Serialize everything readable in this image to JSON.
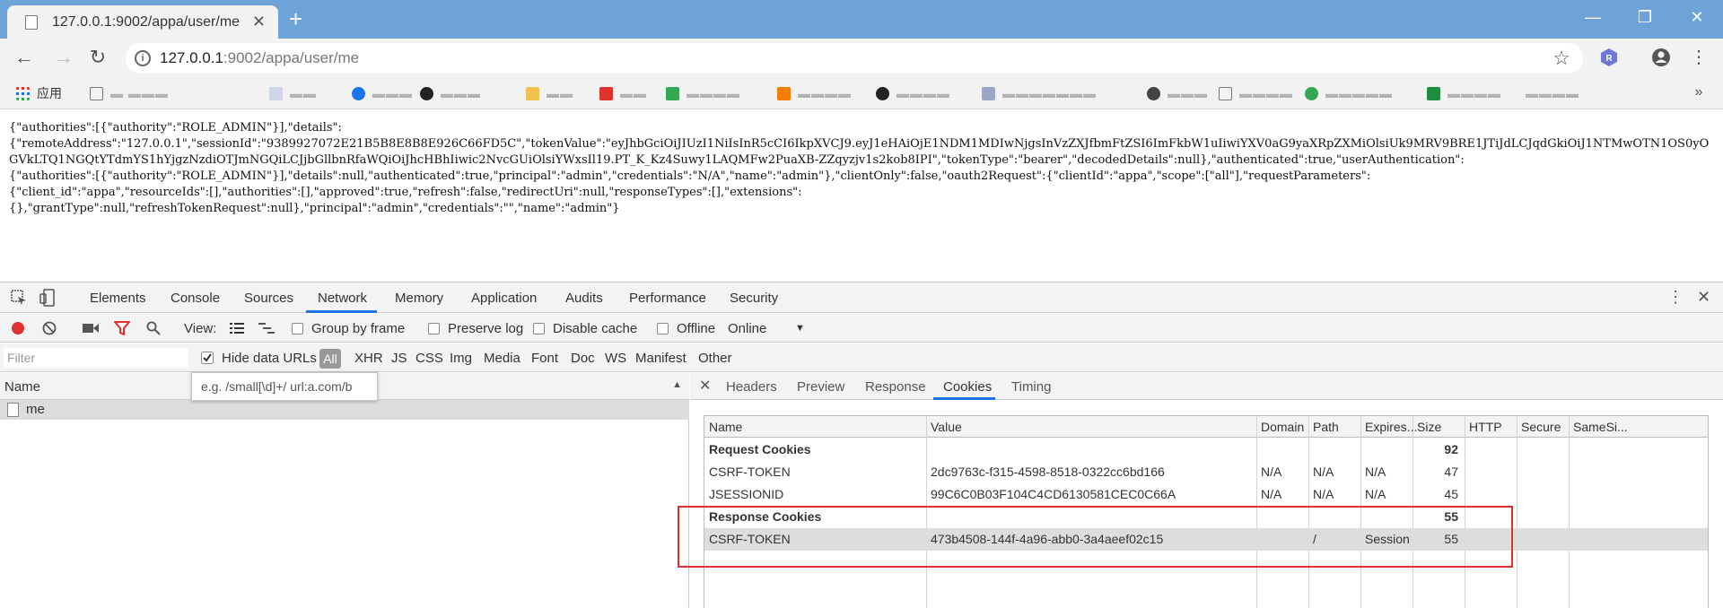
{
  "browser": {
    "tab_title": "127.0.0.1:9002/appa/user/me",
    "url_host": "127.0.0.1",
    "url_rest": ":9002/appa/user/me",
    "new_tab_symbol": "+",
    "bookmarks_apps_label": "应用",
    "accent_color": "#6ea3d8"
  },
  "page": {
    "json_text": "{\"authorities\":[{\"authority\":\"ROLE_ADMIN\"}],\"details\":\n{\"remoteAddress\":\"127.0.0.1\",\"sessionId\":\"9389927072E21B5B8E8B8E926C66FD5C\",\"tokenValue\":\"eyJhbGciOiJIUzI1NiIsInR5cCI6IkpXVCJ9.eyJ1eHAiOjE1NDM1MDIwNjgsInVzZXJfbmFtZSI6ImFkbW1uIiwiYXV0aG9yaXRpZXMiOlsiUk9MRV9BRE1JTiJdLCJqdGkiOiJ1NTMwOTN1OS0yOGVkLTQ1NGQtYTdmYS1hYjgzNzdiOTJmNGQiLCJjbGllbnRfaWQiOiJhcHBhIiwic2NvcGUiOlsiYWxsIl19.PT_K_Kz4Suwy1LAQMFw2PuaXB-ZZqyzjv1s2kob8IPI\",\"tokenType\":\"bearer\",\"decodedDetails\":null},\"authenticated\":true,\"userAuthentication\":\n{\"authorities\":[{\"authority\":\"ROLE_ADMIN\"}],\"details\":null,\"authenticated\":true,\"principal\":\"admin\",\"credentials\":\"N/A\",\"name\":\"admin\"},\"clientOnly\":false,\"oauth2Request\":{\"clientId\":\"appa\",\"scope\":[\"all\"],\"requestParameters\":\n{\"client_id\":\"appa\",\"resourceIds\":[],\"authorities\":[],\"approved\":true,\"refresh\":false,\"redirectUri\":null,\"responseTypes\":[],\"extensions\":\n{},\"grantType\":null,\"refreshTokenRequest\":null},\"principal\":\"admin\",\"credentials\":\"\",\"name\":\"admin\"}"
  },
  "devtools": {
    "tabs": [
      "Elements",
      "Console",
      "Sources",
      "Network",
      "Memory",
      "Application",
      "Audits",
      "Performance",
      "Security"
    ],
    "active_tab": "Network",
    "toolbar": {
      "view_label": "View:",
      "group_by_frame": "Group by frame",
      "preserve_log": "Preserve log",
      "disable_cache": "Disable cache",
      "offline": "Offline",
      "throttling": "Online"
    },
    "filter": {
      "placeholder": "Filter",
      "hide_data_urls": "Hide data URLs",
      "types": [
        "All",
        "XHR",
        "JS",
        "CSS",
        "Img",
        "Media",
        "Font",
        "Doc",
        "WS",
        "Manifest",
        "Other"
      ],
      "hint": "e.g. /small[\\d]+/ url:a.com/b"
    },
    "requests": {
      "header": "Name",
      "items": [
        "me"
      ]
    },
    "detail_tabs": [
      "Headers",
      "Preview",
      "Response",
      "Cookies",
      "Timing"
    ],
    "active_detail_tab": "Cookies",
    "cookies": {
      "columns": [
        "Name",
        "Value",
        "Domain",
        "Path",
        "Expires...",
        "Size",
        "HTTP",
        "Secure",
        "SameSi..."
      ],
      "request_section": {
        "label": "Request Cookies",
        "size": "92"
      },
      "request_rows": [
        {
          "name": "CSRF-TOKEN",
          "value": "2dc9763c-f315-4598-8518-0322cc6bd166",
          "domain": "N/A",
          "path": "N/A",
          "expires": "N/A",
          "size": "47"
        },
        {
          "name": "JSESSIONID",
          "value": "99C6C0B03F104C4CD6130581CEC0C66A",
          "domain": "N/A",
          "path": "N/A",
          "expires": "N/A",
          "size": "45"
        }
      ],
      "response_section": {
        "label": "Response Cookies",
        "size": "55"
      },
      "response_rows": [
        {
          "name": "CSRF-TOKEN",
          "value": "473b4508-144f-4a96-abb0-3a4aeef02c15",
          "domain": "",
          "path": "/",
          "expires": "Session",
          "size": "55"
        }
      ]
    },
    "highlight_color": "#e03030"
  }
}
